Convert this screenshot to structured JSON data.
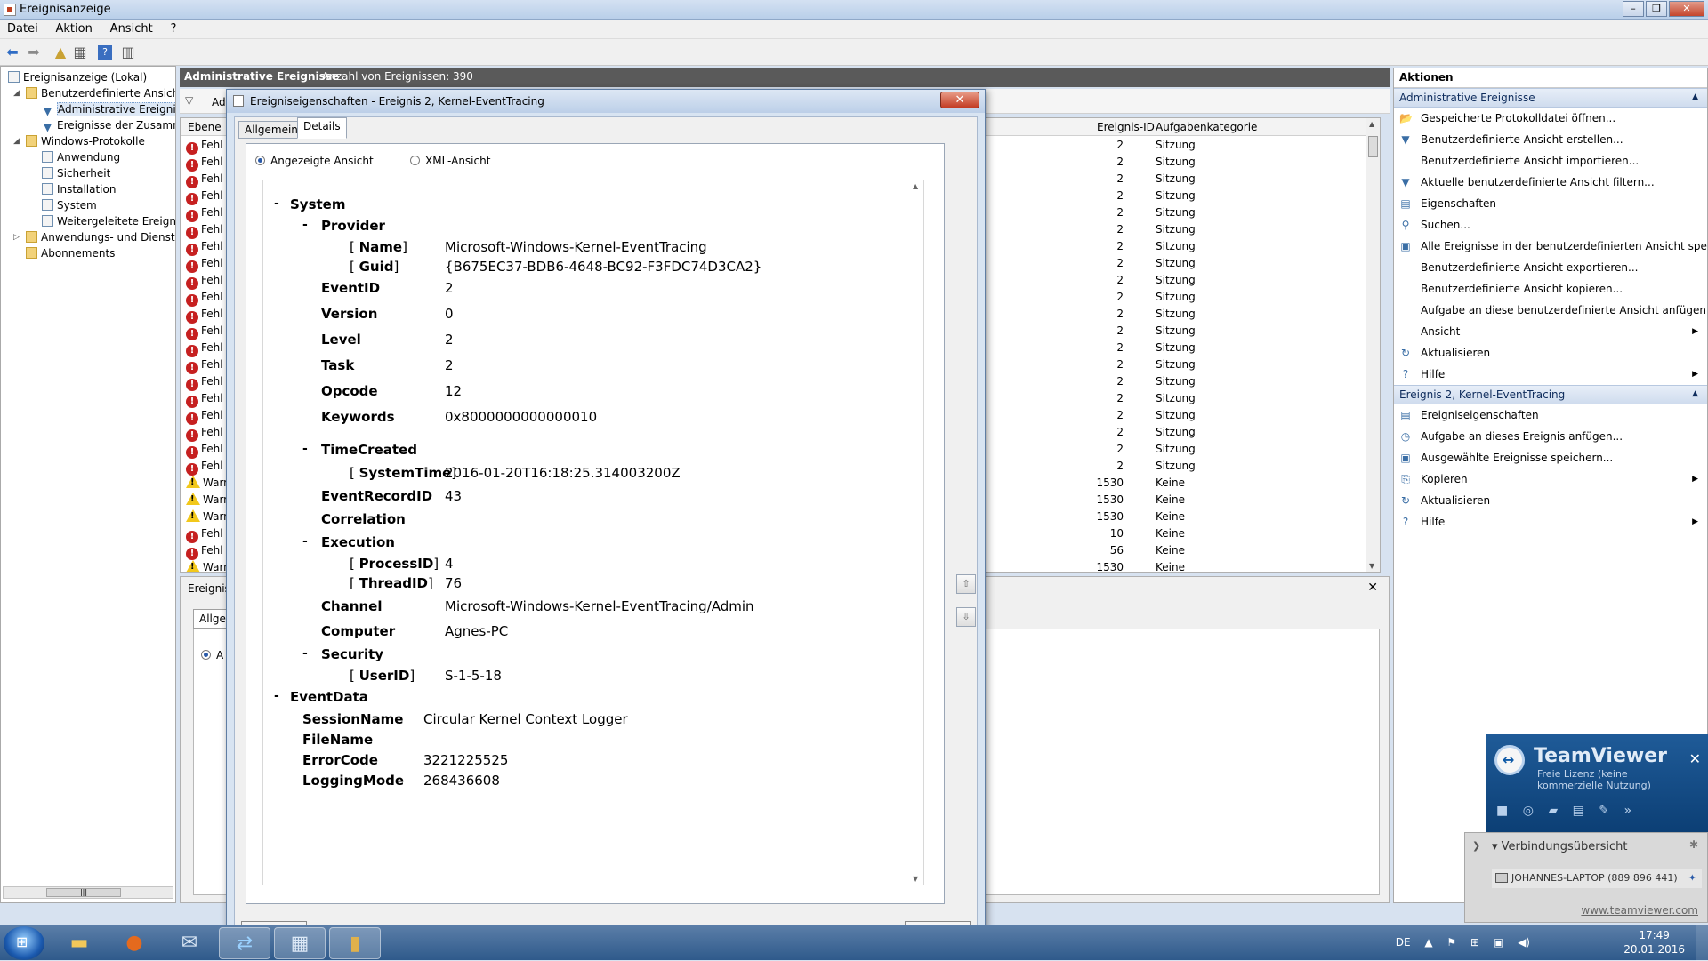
{
  "window": {
    "title": "Ereignisanzeige",
    "btn_min": "–",
    "btn_max": "❐",
    "btn_close": "✕"
  },
  "menu": {
    "file": "Datei",
    "action": "Aktion",
    "view": "Ansicht",
    "help": "?"
  },
  "toolbar": {
    "back_icon": "back-arrow-icon",
    "forward_icon": "forward-arrow-icon"
  },
  "tree": {
    "root": "Ereignisanzeige (Lokal)",
    "custom_views": "Benutzerdefinierte Ansichten",
    "admin_events": "Administrative Ereignisse",
    "summary": "Ereignisse der Zusammenfassung",
    "windows_logs": "Windows-Protokolle",
    "application": "Anwendung",
    "security": "Sicherheit",
    "setup": "Installation",
    "system": "System",
    "forwarded": "Weitergeleitete Ereignisse",
    "app_services": "Anwendungs- und Dienstprotokolle",
    "subscriptions": "Abonnements"
  },
  "center": {
    "header_title": "Administrative Ereignisse",
    "header_count": "Anzahl von Ereignissen: 390",
    "filter_label": "Ad",
    "col_level": "Ebene",
    "col_event_id": "Ereignis-ID",
    "col_task": "Aufgabenkategorie",
    "rows": [
      {
        "level": "Fehl",
        "type": "error",
        "id": "2",
        "cat": "Sitzung"
      },
      {
        "level": "Fehl",
        "type": "error",
        "id": "2",
        "cat": "Sitzung"
      },
      {
        "level": "Fehl",
        "type": "error",
        "id": "2",
        "cat": "Sitzung"
      },
      {
        "level": "Fehl",
        "type": "error",
        "id": "2",
        "cat": "Sitzung"
      },
      {
        "level": "Fehl",
        "type": "error",
        "id": "2",
        "cat": "Sitzung"
      },
      {
        "level": "Fehl",
        "type": "error",
        "id": "2",
        "cat": "Sitzung"
      },
      {
        "level": "Fehl",
        "type": "error",
        "id": "2",
        "cat": "Sitzung"
      },
      {
        "level": "Fehl",
        "type": "error",
        "id": "2",
        "cat": "Sitzung"
      },
      {
        "level": "Fehl",
        "type": "error",
        "id": "2",
        "cat": "Sitzung"
      },
      {
        "level": "Fehl",
        "type": "error",
        "id": "2",
        "cat": "Sitzung"
      },
      {
        "level": "Fehl",
        "type": "error",
        "id": "2",
        "cat": "Sitzung"
      },
      {
        "level": "Fehl",
        "type": "error",
        "id": "2",
        "cat": "Sitzung"
      },
      {
        "level": "Fehl",
        "type": "error",
        "id": "2",
        "cat": "Sitzung"
      },
      {
        "level": "Fehl",
        "type": "error",
        "id": "2",
        "cat": "Sitzung"
      },
      {
        "level": "Fehl",
        "type": "error",
        "id": "2",
        "cat": "Sitzung"
      },
      {
        "level": "Fehl",
        "type": "error",
        "id": "2",
        "cat": "Sitzung"
      },
      {
        "level": "Fehl",
        "type": "error",
        "id": "2",
        "cat": "Sitzung"
      },
      {
        "level": "Fehl",
        "type": "error",
        "id": "2",
        "cat": "Sitzung"
      },
      {
        "level": "Fehl",
        "type": "error",
        "id": "2",
        "cat": "Sitzung"
      },
      {
        "level": "Fehl",
        "type": "error",
        "id": "2",
        "cat": "Sitzung"
      },
      {
        "level": "Warn",
        "type": "warning",
        "id": "1530",
        "cat": "Keine"
      },
      {
        "level": "Warn",
        "type": "warning",
        "id": "1530",
        "cat": "Keine"
      },
      {
        "level": "Warn",
        "type": "warning",
        "id": "1530",
        "cat": "Keine"
      },
      {
        "level": "Fehl",
        "type": "error",
        "id": "10",
        "cat": "Keine"
      },
      {
        "level": "Fehl",
        "type": "error",
        "id": "56",
        "cat": "Keine"
      },
      {
        "level": "Warn",
        "type": "warning",
        "id": "1530",
        "cat": "Keine"
      }
    ],
    "detail_title": "Ereignis",
    "detail_tab": "Allgem",
    "detail_radio": "A"
  },
  "actions": {
    "header": "Aktionen",
    "section1": "Administrative Ereignisse",
    "items1": [
      {
        "label": "Gespeicherte Protokolldatei öffnen...",
        "icon": "folder-open-icon",
        "glyph": "📂"
      },
      {
        "label": "Benutzerdefinierte Ansicht erstellen...",
        "icon": "filter-icon",
        "glyph": "▼"
      },
      {
        "label": "Benutzerdefinierte Ansicht importieren...",
        "icon": "",
        "glyph": ""
      },
      {
        "label": "Aktuelle benutzerdefinierte Ansicht filtern...",
        "icon": "filter-icon",
        "glyph": "▼"
      },
      {
        "label": "Eigenschaften",
        "icon": "properties-icon",
        "glyph": "▤"
      },
      {
        "label": "Suchen...",
        "icon": "binoculars-icon",
        "glyph": "⚲"
      },
      {
        "label": "Alle Ereignisse in der benutzerdefinierten Ansicht speic...",
        "icon": "save-icon",
        "glyph": "▣"
      },
      {
        "label": "Benutzerdefinierte Ansicht exportieren...",
        "icon": "",
        "glyph": ""
      },
      {
        "label": "Benutzerdefinierte Ansicht kopieren...",
        "icon": "",
        "glyph": ""
      },
      {
        "label": "Aufgabe an diese benutzerdefinierte Ansicht anfügen...",
        "icon": "",
        "glyph": ""
      },
      {
        "label": "Ansicht",
        "icon": "",
        "glyph": "",
        "submenu": "▶"
      },
      {
        "label": "Aktualisieren",
        "icon": "refresh-icon",
        "glyph": "↻"
      },
      {
        "label": "Hilfe",
        "icon": "help-icon",
        "glyph": "?",
        "submenu": "▶"
      }
    ],
    "section2": "Ereignis 2, Kernel-EventTracing",
    "items2": [
      {
        "label": "Ereigniseigenschaften",
        "icon": "properties-icon",
        "glyph": "▤"
      },
      {
        "label": "Aufgabe an dieses Ereignis anfügen...",
        "icon": "task-icon",
        "glyph": "◷"
      },
      {
        "label": "Ausgewählte Ereignisse speichern...",
        "icon": "save-icon",
        "glyph": "▣"
      },
      {
        "label": "Kopieren",
        "icon": "copy-icon",
        "glyph": "⎘",
        "submenu": "▶"
      },
      {
        "label": "Aktualisieren",
        "icon": "refresh-icon",
        "glyph": "↻"
      },
      {
        "label": "Hilfe",
        "icon": "help-icon",
        "glyph": "?",
        "submenu": "▶"
      }
    ]
  },
  "dialog": {
    "title": "Ereigniseigenschaften - Ereignis 2, Kernel-EventTracing",
    "close": "✕",
    "tab_general": "Allgemein",
    "tab_details": "Details",
    "radio_friendly": "Angezeigte Ansicht",
    "radio_xml": "XML-Ansicht",
    "system": "System",
    "provider": "Provider",
    "name_key": "Name",
    "name_val": "Microsoft-Windows-Kernel-EventTracing",
    "guid_key": "Guid",
    "guid_val": "{B675EC37-BDB6-4648-BC92-F3FDC74D3CA2}",
    "fields": [
      {
        "k": "EventID",
        "v": "2"
      },
      {
        "k": "Version",
        "v": "0"
      },
      {
        "k": "Level",
        "v": "2"
      },
      {
        "k": "Task",
        "v": "2"
      },
      {
        "k": "Opcode",
        "v": "12"
      },
      {
        "k": "Keywords",
        "v": "0x8000000000000010"
      }
    ],
    "timecreated": "TimeCreated",
    "systemtime_key": "SystemTime",
    "systemtime_val": "2016-01-20T16:18:25.314003200Z",
    "recordid_key": "EventRecordID",
    "recordid_val": "43",
    "correlation": "Correlation",
    "execution": "Execution",
    "processid_key": "ProcessID",
    "processid_val": "4",
    "threadid_key": "ThreadID",
    "threadid_val": "76",
    "channel_key": "Channel",
    "channel_val": "Microsoft-Windows-Kernel-EventTracing/Admin",
    "computer_key": "Computer",
    "computer_val": "Agnes-PC",
    "security": "Security",
    "userid_key": "UserID",
    "userid_val": "S-1-5-18",
    "eventdata": "EventData",
    "data": [
      {
        "k": "SessionName",
        "v": "Circular Kernel Context Logger"
      },
      {
        "k": "FileName",
        "v": ""
      },
      {
        "k": "ErrorCode",
        "v": "3221225525"
      },
      {
        "k": "LoggingMode",
        "v": "268436608"
      }
    ],
    "collapse": "-"
  },
  "teamviewer": {
    "name": "TeamViewer",
    "license": "Freie Lizenz (keine kommerzielle Nutzung)",
    "overview": "Verbindungsübersicht",
    "partner": "JOHANNES-LAPTOP (889 896 441)",
    "link": "www.teamviewer.com"
  },
  "taskbar": {
    "lang": "DE",
    "time": "17:49",
    "date": "20.01.2016"
  },
  "colors": {
    "error": "#c62020",
    "warning": "#f2c81b",
    "header": "#5a5a5a",
    "accent": "#2a5aa8"
  }
}
